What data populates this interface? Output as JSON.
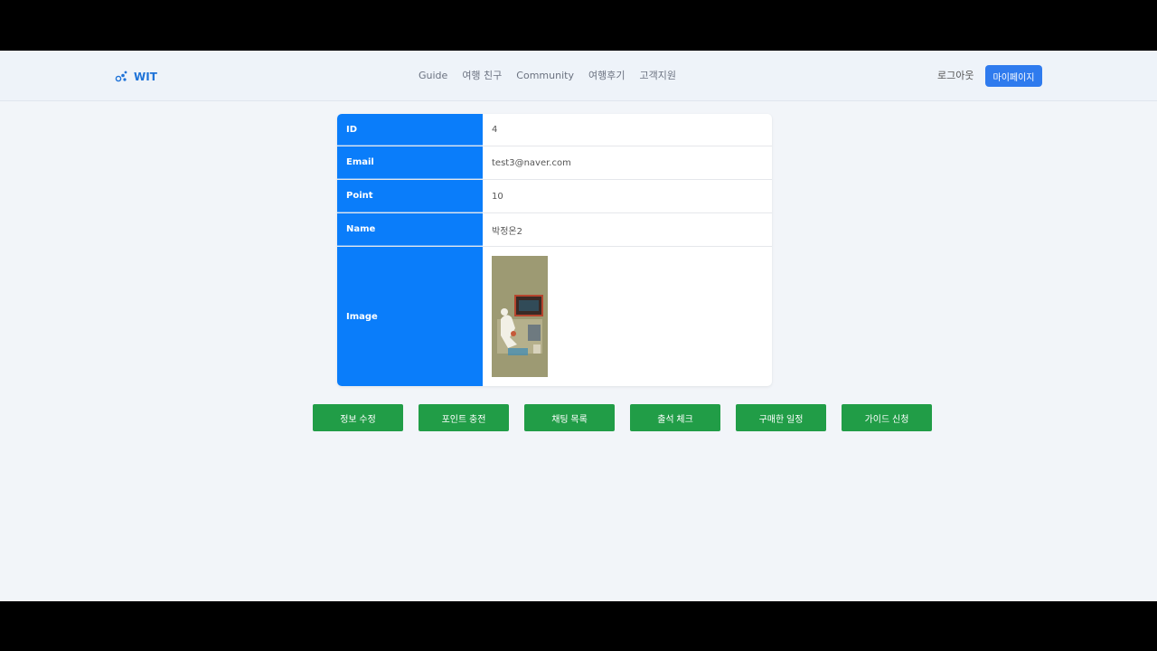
{
  "brand": {
    "name": "WIT"
  },
  "nav": {
    "links": [
      "Guide",
      "여행 친구",
      "Community",
      "여행후기",
      "고객지원"
    ],
    "logout_label": "로그아웃",
    "mypage_label": "마이페이지"
  },
  "profile": {
    "rows": [
      {
        "label": "ID",
        "value": "4"
      },
      {
        "label": "Email",
        "value": "test3@naver.com"
      },
      {
        "label": "Point",
        "value": "10"
      },
      {
        "label": "Name",
        "value": "박정온2"
      }
    ],
    "image_label": "Image"
  },
  "actions": [
    "정보 수정",
    "포인트 충전",
    "채팅 목록",
    "출석 체크",
    "구매한 일정",
    "가이드 신청"
  ],
  "colors": {
    "accent": "#0a7dfa",
    "button_green": "#219d47",
    "mypage_blue": "#2f7bee",
    "brand_blue": "#1e73d8"
  }
}
